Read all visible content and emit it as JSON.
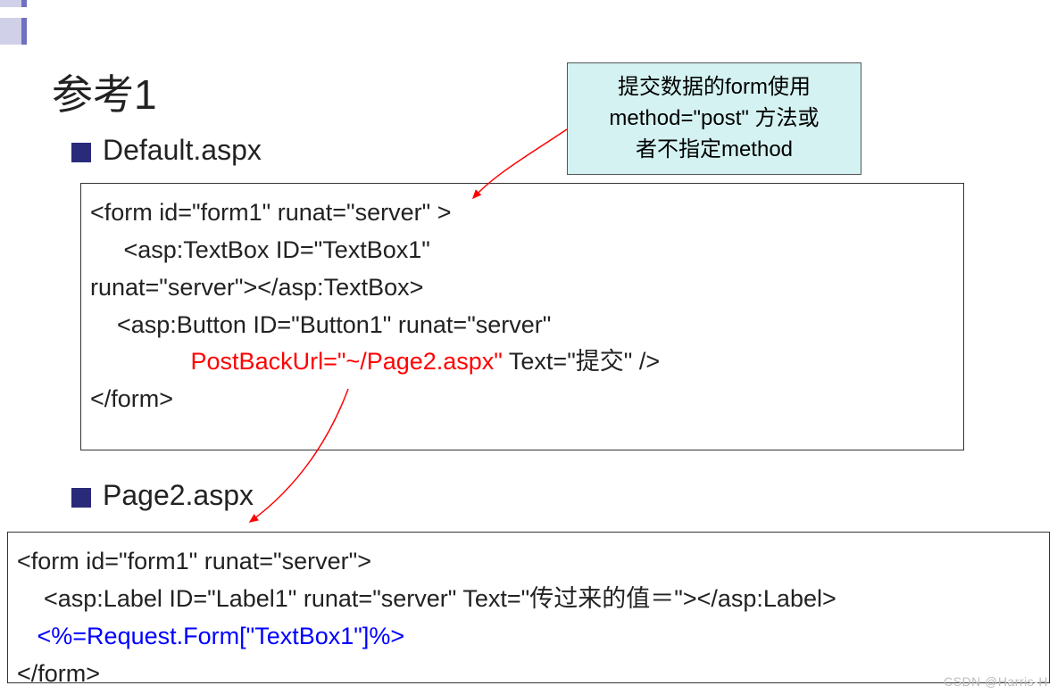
{
  "title": "参考1",
  "headings": {
    "default": "Default.aspx",
    "page2": "Page2.aspx"
  },
  "callout": {
    "line1": "提交数据的form使用",
    "line2": "method=\"post\" 方法或",
    "line3": "者不指定method"
  },
  "code1": {
    "l1": "<form id=\"form1\" runat=\"server\" >",
    "l2": "     <asp:TextBox ID=\"TextBox1\"",
    "l3": "runat=\"server\"></asp:TextBox>",
    "l4": "    <asp:Button ID=\"Button1\" runat=\"server\"",
    "l5a": "               ",
    "l5b": "PostBackUrl=\"~/Page2.aspx\"",
    "l5c": " Text=\"提交\" />",
    "l6": "</form>"
  },
  "code2": {
    "l1": "<form id=\"form1\" runat=\"server\">",
    "l2": "    <asp:Label ID=\"Label1\" runat=\"server\" Text=\"传过来的值＝\"></asp:Label>",
    "l3a": "   ",
    "l3b": "<%=Request.Form[\"TextBox1\"]%>",
    "l4": "</form>"
  },
  "watermark": "CSDN @Harris-H"
}
